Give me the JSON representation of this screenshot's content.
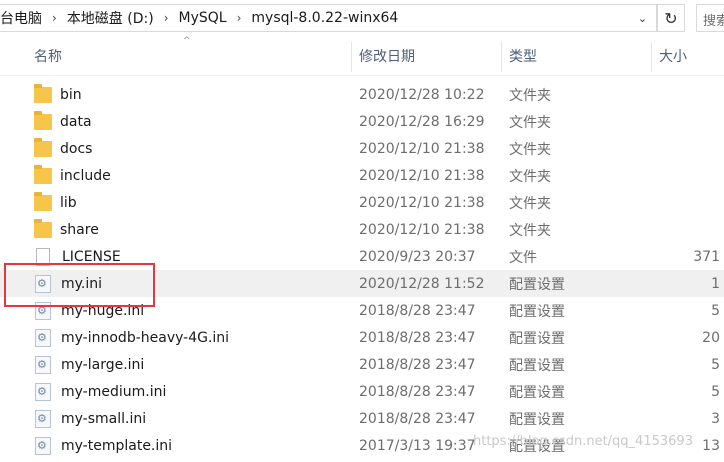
{
  "address": {
    "crumbs": [
      "台电脑",
      "本地磁盘 (D:)",
      "MySQL",
      "mysql-8.0.22-winx64"
    ],
    "separator": "›",
    "dropdown_glyph": "⌄",
    "refresh_glyph": "↻",
    "search_placeholder": "搜索"
  },
  "columns": {
    "name": "名称",
    "date": "修改日期",
    "type": "类型",
    "size": "大小",
    "sort_glyph": "^"
  },
  "files": [
    {
      "name": "bin",
      "date": "2020/12/28 10:22",
      "type": "文件夹",
      "size": "",
      "icon": "folder-icon"
    },
    {
      "name": "data",
      "date": "2020/12/28 16:29",
      "type": "文件夹",
      "size": "",
      "icon": "folder-icon"
    },
    {
      "name": "docs",
      "date": "2020/12/10 21:38",
      "type": "文件夹",
      "size": "",
      "icon": "folder-icon"
    },
    {
      "name": "include",
      "date": "2020/12/10 21:38",
      "type": "文件夹",
      "size": "",
      "icon": "folder-icon"
    },
    {
      "name": "lib",
      "date": "2020/12/10 21:38",
      "type": "文件夹",
      "size": "",
      "icon": "folder-icon"
    },
    {
      "name": "share",
      "date": "2020/12/10 21:38",
      "type": "文件夹",
      "size": "",
      "icon": "folder-icon"
    },
    {
      "name": "LICENSE",
      "date": "2020/9/23 20:37",
      "type": "文件",
      "size": "371",
      "icon": "document-icon"
    },
    {
      "name": "my.ini",
      "date": "2020/12/28 11:52",
      "type": "配置设置",
      "size": "1",
      "icon": "config-file-icon"
    },
    {
      "name": "my-huge.ini",
      "date": "2018/8/28 23:47",
      "type": "配置设置",
      "size": "5",
      "icon": "config-file-icon"
    },
    {
      "name": "my-innodb-heavy-4G.ini",
      "date": "2018/8/28 23:47",
      "type": "配置设置",
      "size": "20",
      "icon": "config-file-icon"
    },
    {
      "name": "my-large.ini",
      "date": "2018/8/28 23:47",
      "type": "配置设置",
      "size": "5",
      "icon": "config-file-icon"
    },
    {
      "name": "my-medium.ini",
      "date": "2018/8/28 23:47",
      "type": "配置设置",
      "size": "5",
      "icon": "config-file-icon"
    },
    {
      "name": "my-small.ini",
      "date": "2018/8/28 23:47",
      "type": "配置设置",
      "size": "3",
      "icon": "config-file-icon"
    },
    {
      "name": "my-template.ini",
      "date": "2017/3/13 19:37",
      "type": "配置设置",
      "size": "13",
      "icon": "config-file-icon"
    }
  ],
  "highlight_color": "#e0393e",
  "watermark": "https://blog.csdn.net/qq_4153693"
}
